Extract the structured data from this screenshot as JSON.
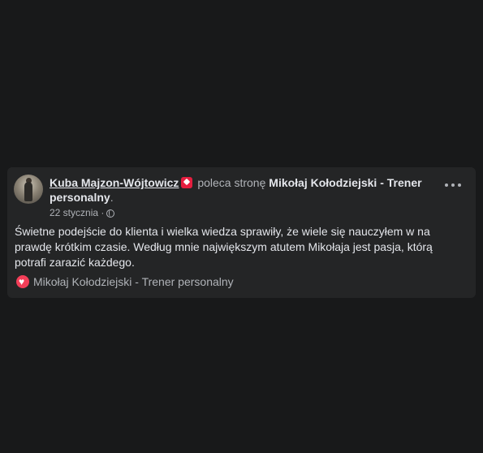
{
  "post": {
    "author": "Kuba Majzon-Wójtowicz",
    "recommends_text": "poleca stronę",
    "page_name": "Mikołaj Kołodziejski - Trener personalny",
    "period": ".",
    "date": "22 stycznia",
    "separator": "·",
    "privacy_icon": "globe-icon",
    "badge_icon": "recommend-badge-icon",
    "body": "Świetne podejście do klienta i wielka wiedza sprawiły, że wiele się nauczyłem w na prawdę krótkim czasie. Według mnie największym atutem Mikołaja jest pasja, którą potrafi zarazić każdego.",
    "footer_page_name": "Mikołaj Kołodziejski - Trener personalny",
    "footer_icon": "heart-icon"
  },
  "colors": {
    "background": "#18191a",
    "card": "#242526",
    "primary_text": "#e4e6eb",
    "secondary_text": "#b0b3b8",
    "badge": "#e41e3f",
    "heart": "#f33e58"
  }
}
